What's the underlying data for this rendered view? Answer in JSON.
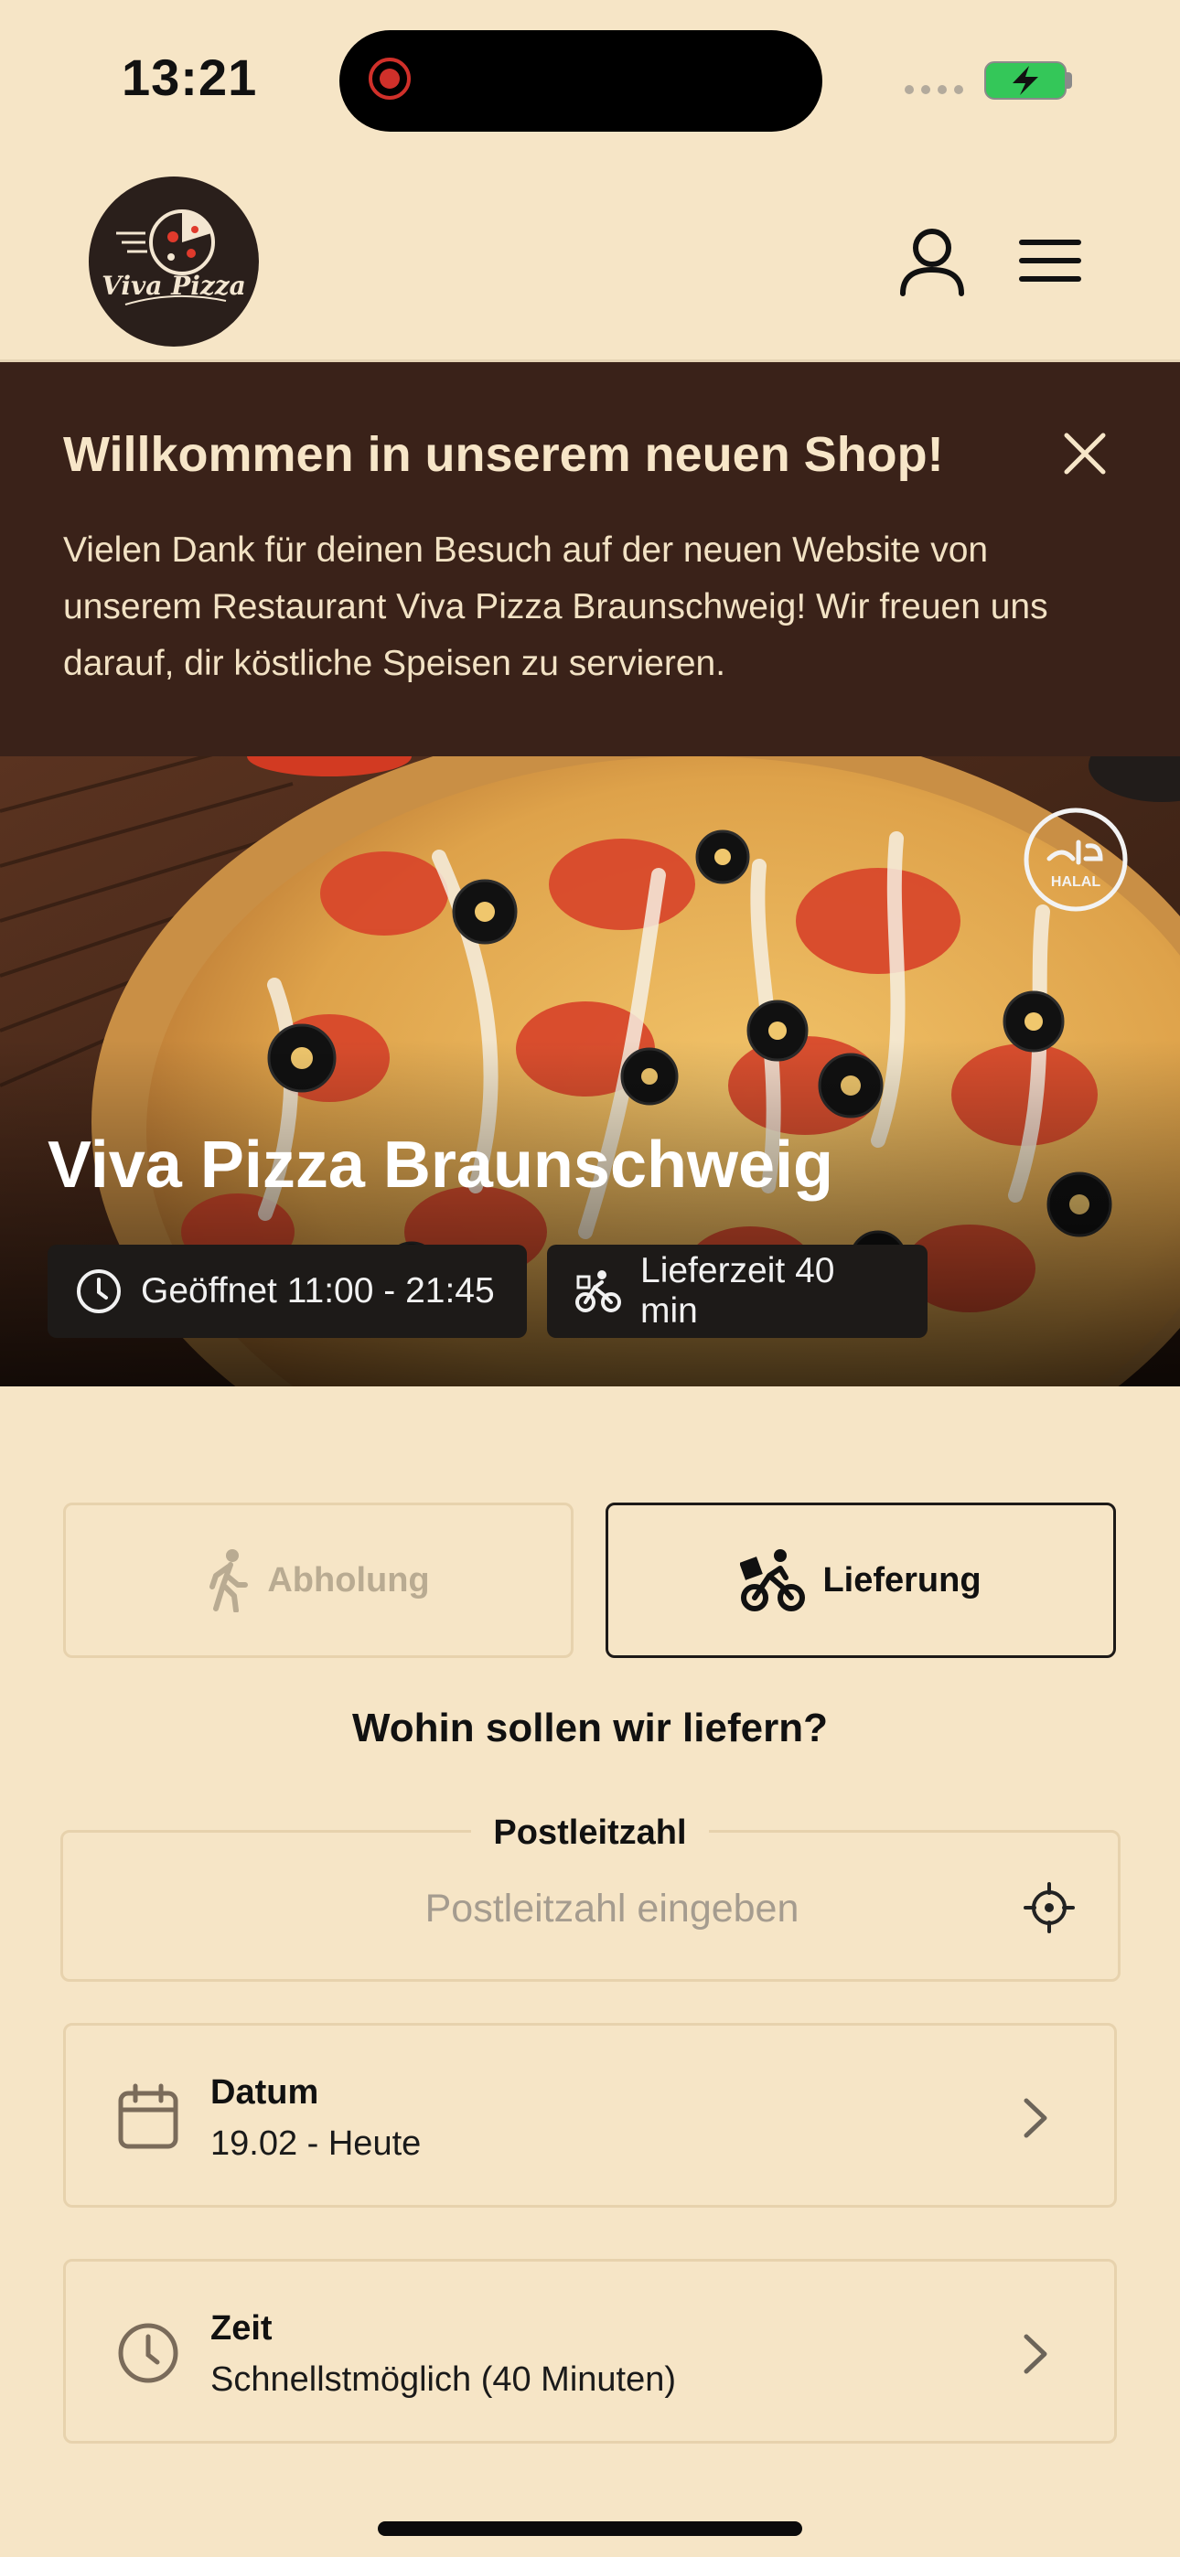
{
  "status_bar": {
    "time": "13:21"
  },
  "header": {
    "logo_text": "Viva Pizza"
  },
  "banner": {
    "title": "Willkommen in unserem neuen Shop!",
    "text": "Vielen Dank für deinen Besuch auf der neuen Website von unserem Restaurant Viva Pizza Braunschweig! Wir freuen uns darauf, dir köstliche Speisen zu servieren."
  },
  "hero": {
    "title": "Viva Pizza Braunschweig",
    "badge": "HALAL",
    "opening": "Geöffnet 11:00 - 21:45",
    "delivery_time": "Lieferzeit 40 min"
  },
  "modes": {
    "pickup": "Abholung",
    "delivery": "Lieferung",
    "selected": "delivery"
  },
  "question": "Wohin sollen wir liefern?",
  "postcode": {
    "label": "Postleitzahl",
    "placeholder": "Postleitzahl eingeben",
    "value": ""
  },
  "date": {
    "label": "Datum",
    "value": "19.02 - Heute"
  },
  "time": {
    "label": "Zeit",
    "value": "Schnellstmöglich (40 Minuten)"
  },
  "colors": {
    "background": "#f6e5c6",
    "banner": "#3a2219",
    "dark": "#1d1a18",
    "border": "#e7d2ad",
    "battery": "#34c759"
  },
  "icons": [
    "user-icon",
    "menu-icon",
    "close-icon",
    "clock-icon",
    "bike-icon",
    "walk-icon",
    "locate-icon",
    "calendar-icon",
    "chevron-right-icon",
    "halal-icon"
  ]
}
